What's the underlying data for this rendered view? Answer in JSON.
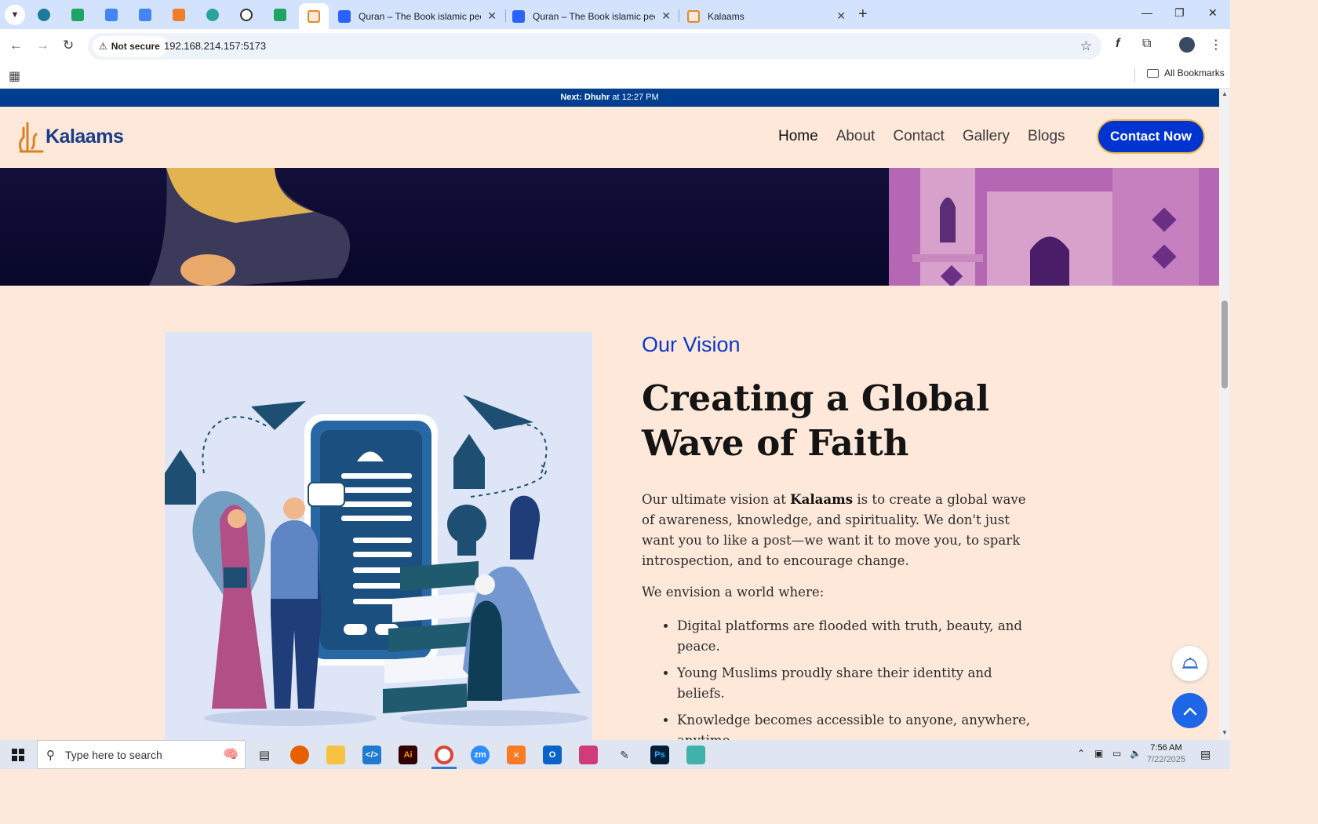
{
  "browser": {
    "tabs": [
      {
        "title": "Quran – The Book islamic peopl",
        "active": false
      },
      {
        "title": "Quran – The Book islamic peopl",
        "active": false
      },
      {
        "title": "Kalaams",
        "active": false
      }
    ],
    "new_tab": "+",
    "not_secure_label": "Not secure",
    "url": "192.168.214.157:5173",
    "bookmarks_folder": "All Bookmarks"
  },
  "site": {
    "prayer_bar": {
      "prefix": "Next:",
      "prayer": "Dhuhr",
      "suffix": "at 12:27 PM"
    },
    "logo_text": "Kalaams",
    "nav": [
      "Home",
      "About",
      "Contact",
      "Gallery",
      "Blogs"
    ],
    "cta": "Contact Now",
    "vision": {
      "kicker": "Our Vision",
      "headline": "Creating a Global Wave of Faith",
      "para_before": "Our ultimate vision at ",
      "para_bold": "Kalaams",
      "para_after": " is to create a global wave of awareness, knowledge, and spirituality. We don't just want you to like a post—we want it to move you, to spark introspection, and to encourage change.",
      "envision": "We envision a world where:",
      "points": [
        "Digital platforms are flooded with truth, beauty, and peace.",
        "Young Muslims proudly share their identity and beliefs.",
        "Knowledge becomes accessible to anyone, anywhere, anytime."
      ]
    }
  },
  "taskbar": {
    "search_placeholder": "Type here to search",
    "time": "7:56 AM",
    "date": "7/22/2025"
  },
  "colors": {
    "page_bg": "#fde8da",
    "prayer_bar": "#003f8f",
    "accent_blue": "#0034d0",
    "cta_border": "#f2b94a",
    "kicker": "#0d38c9"
  }
}
